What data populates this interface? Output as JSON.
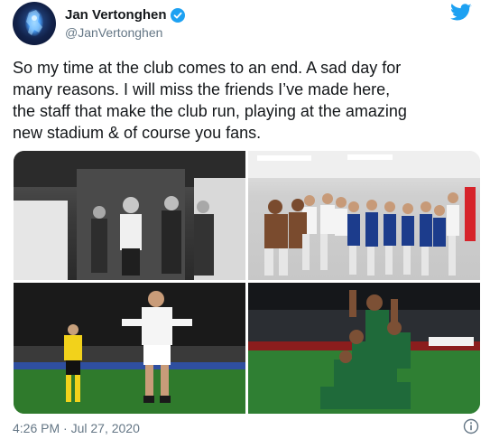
{
  "author": {
    "display_name": "Jan Vertonghen",
    "handle": "@JanVertonghen",
    "verified": true
  },
  "tweet": {
    "text": "So my time at the club comes to an end. A sad day for\nmany reasons. I will miss the friends I’ve made here,\nthe staff that make the club run, playing at the amazing\nnew stadium & of course you fans.",
    "timestamp": "4:26 PM · Jul 27, 2020"
  },
  "media": {
    "photos": [
      {
        "name": "black-and-white-tunnel-photo"
      },
      {
        "name": "team-celebration-dressing-room-photo"
      },
      {
        "name": "player-celebrating-on-pitch-photo"
      },
      {
        "name": "players-pile-celebration-photo"
      }
    ]
  },
  "icons": {
    "verified": "verified-badge-icon",
    "brand": "twitter-bird-icon",
    "info": "info-icon"
  },
  "colors": {
    "brand": "#1da1f2",
    "text": "#14171a",
    "secondary": "#657786"
  }
}
